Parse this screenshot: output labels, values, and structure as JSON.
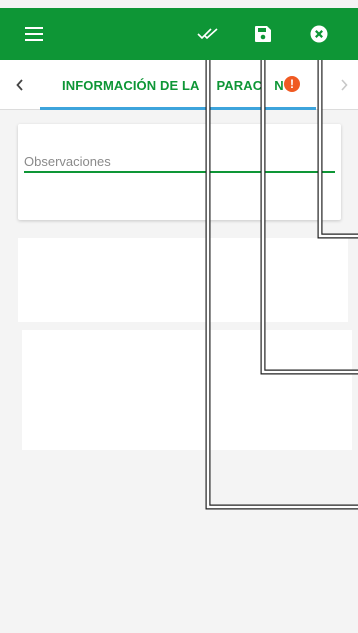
{
  "appbar": {
    "background": "#0e9636",
    "menu_icon": "hamburger-menu-icon",
    "actions": [
      {
        "icon": "double-check-icon"
      },
      {
        "icon": "floppy-disk-save-icon"
      },
      {
        "icon": "close-circle-icon"
      }
    ]
  },
  "tabs": {
    "prev_icon": "chevron-left-icon",
    "next_icon": "chevron-right-icon",
    "active_label": "INFORMACIÓN DE LA",
    "active_label_tail": "PARAC",
    "active_label_end": "N",
    "badge": "!",
    "badge_color": "#f05a22",
    "underline_color": "#3da4dc"
  },
  "form": {
    "observations_placeholder": "Observaciones"
  }
}
